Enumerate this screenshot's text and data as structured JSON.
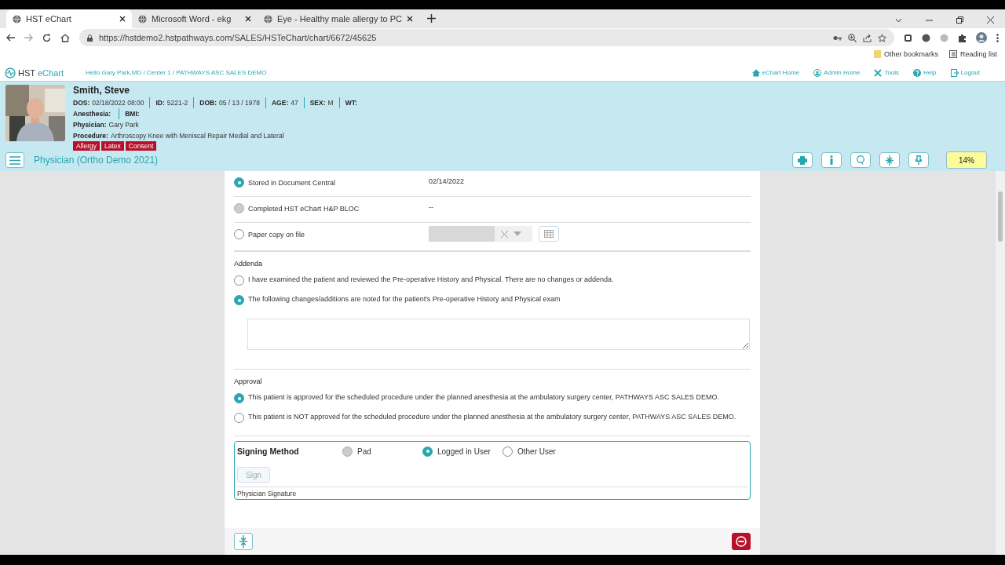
{
  "browser": {
    "tabs": [
      {
        "title": "HST eChart",
        "selected": true
      },
      {
        "title": "Microsoft Word - ekg",
        "selected": false
      },
      {
        "title": "Eye - Healthy male allergy to PC",
        "selected": false
      }
    ],
    "url": "https://hstdemo2.hstpathways.com/SALES/HSTeChart/chart/6672/45625",
    "bookmarks": [
      "Other bookmarks",
      "Reading list"
    ]
  },
  "app": {
    "logo": {
      "brand": "HST",
      "product": "eChart"
    },
    "greeting": "Hello Gary Park,MD / Center 1 / PATHWAYS ASC SALES DEMO",
    "nav": [
      {
        "kind": "home",
        "label": "eChart Home"
      },
      {
        "kind": "admin",
        "label": "Admin Home"
      },
      {
        "kind": "tools",
        "label": "Tools"
      },
      {
        "kind": "help",
        "label": "Help"
      },
      {
        "kind": "logout",
        "label": "Logout"
      }
    ]
  },
  "patient": {
    "photo": {
      "kind": "picture"
    },
    "name": "Smith, Steve",
    "lines": [
      {
        "fields": [
          {
            "label": "DOS:",
            "value": "02/18/2022 08:00"
          },
          {
            "label": "ID:",
            "value": "5221-2"
          },
          {
            "label": "DOB:",
            "value": "05 / 13 / 1978"
          },
          {
            "label": "AGE:",
            "value": "47"
          },
          {
            "label": "SEX:",
            "value": "M"
          },
          {
            "label": "WT:"
          }
        ]
      },
      {
        "fields": [
          {
            "label": "Anesthesia:"
          },
          {
            "label": "BMI:"
          }
        ]
      },
      {
        "fields": [
          {
            "label": "Physician:",
            "value": "Gary Park"
          }
        ]
      },
      {
        "fields": [
          {
            "label": "Procedure:",
            "value": "Arthroscopy Knee with Meniscal Repair Medial and Lateral"
          }
        ]
      }
    ],
    "alerts": [
      "Allergy",
      "Latex",
      "Consent"
    ]
  },
  "toolbar": {
    "title": "Physician (Ortho Demo 2021)",
    "buttons": [
      {
        "kind": "print"
      },
      {
        "kind": "info"
      },
      {
        "kind": "search"
      },
      {
        "kind": "collapse"
      },
      {
        "kind": "pin"
      }
    ],
    "progress": "14%"
  },
  "documents": [
    {
      "label": "Stored in Document Central",
      "selected": true,
      "disabled": false,
      "kind": "text",
      "value": "02/14/2022"
    },
    {
      "label": "Completed HST eChart H&P BLOC",
      "selected": false,
      "disabled": true,
      "kind": "text",
      "value": "--"
    },
    {
      "label": "Paper copy on file",
      "selected": false,
      "disabled": false,
      "kind": "date-input"
    }
  ],
  "addenda": {
    "heading": "Addenda",
    "options": [
      {
        "label": "I have examined the patient and reviewed the Pre-operative History and Physical. There are no changes or addenda.",
        "selected": false
      },
      {
        "label": "The following changes/additions are noted for the patient's Pre-operative History and Physical exam",
        "selected": true
      }
    ]
  },
  "approval": {
    "heading": "Approval",
    "options": [
      {
        "label": "This patient is approved for the scheduled procedure under the planned anesthesia at the ambulatory surgery center, PATHWAYS ASC SALES DEMO.",
        "selected": true
      },
      {
        "label": "This patient is NOT approved for the scheduled procedure under the planned anesthesia at the ambulatory surgery center, PATHWAYS ASC SALES DEMO.",
        "selected": false
      }
    ]
  },
  "signing": {
    "title": "Signing Method",
    "methods": [
      {
        "label": "Pad",
        "selected": false,
        "disabled": true
      },
      {
        "label": "Logged in User",
        "selected": true,
        "disabled": false
      },
      {
        "label": "Other User",
        "selected": false,
        "disabled": false
      }
    ],
    "sign_button": {
      "label": "Sign",
      "disabled": true
    },
    "signature_label": "Physician Signature"
  }
}
